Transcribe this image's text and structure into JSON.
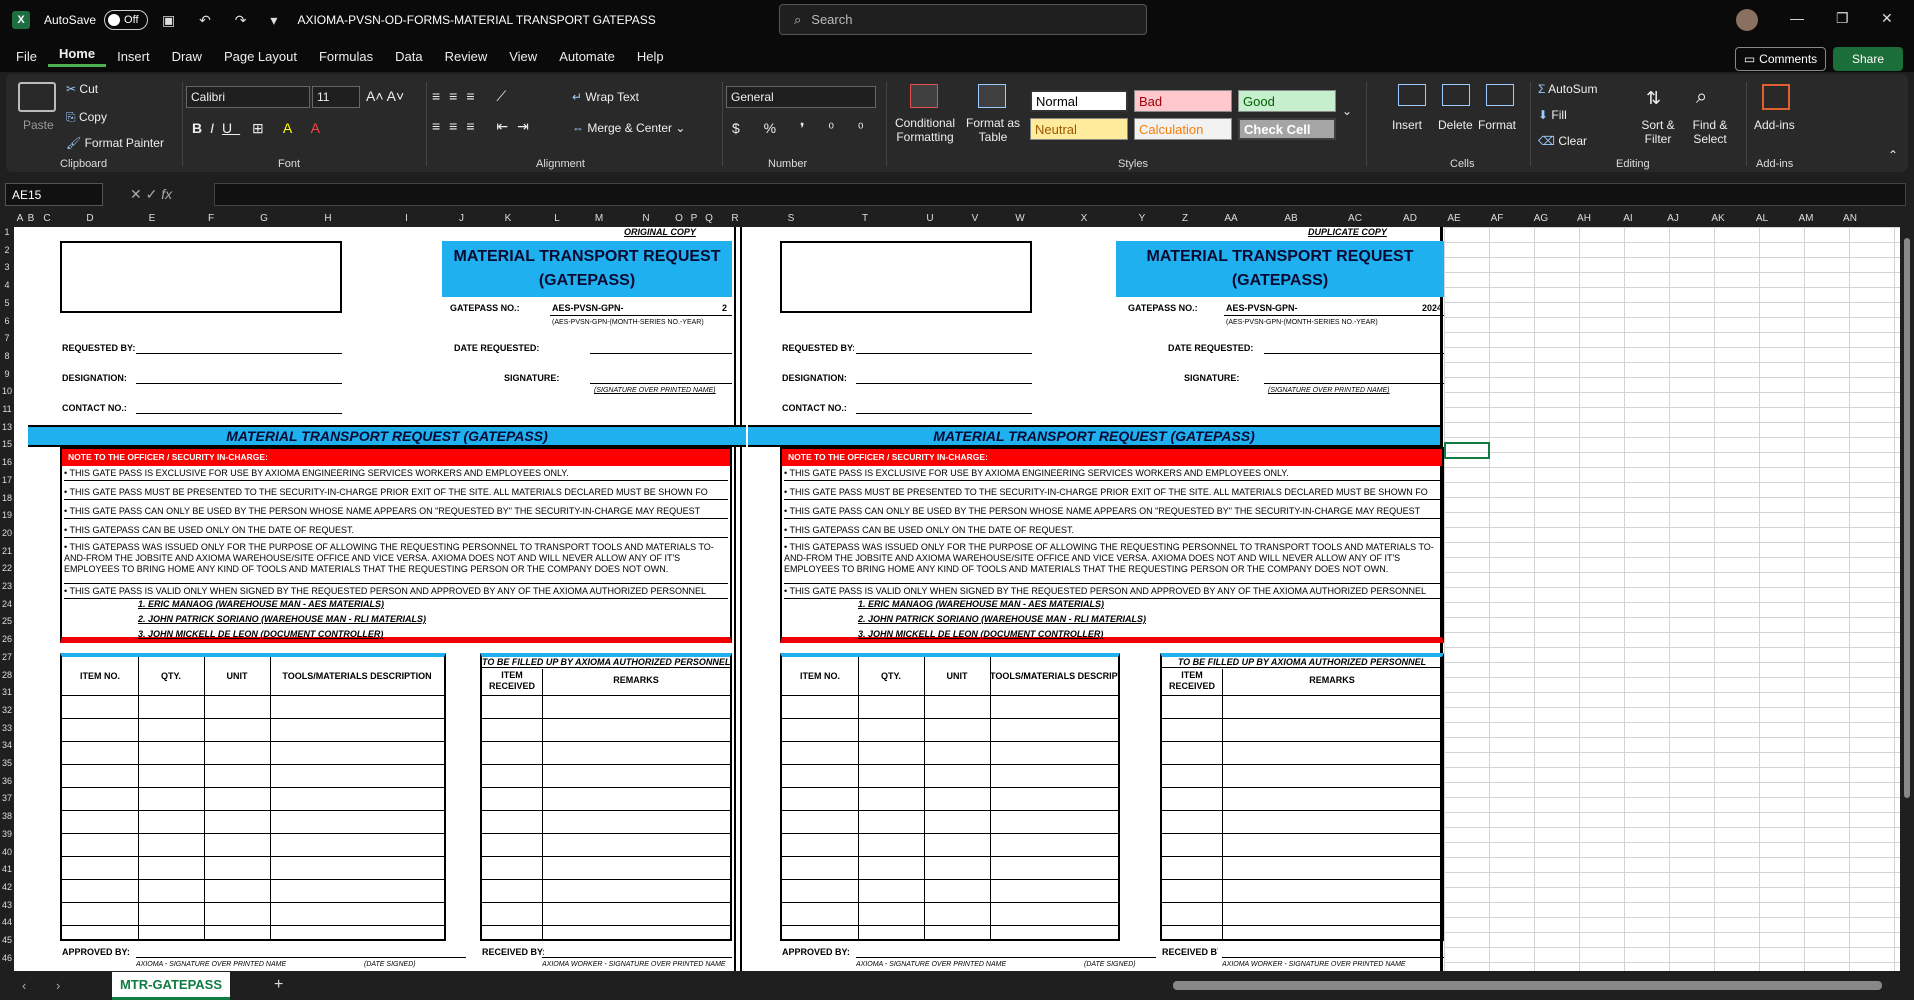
{
  "titlebar": {
    "autosave": "AutoSave",
    "toggle": "Off",
    "doc_title": "AXIOMA-PVSN-OD-FORMS-MATERIAL TRANSPORT GATEPASS",
    "search_placeholder": "Search"
  },
  "menu": {
    "items": [
      "File",
      "Home",
      "Insert",
      "Draw",
      "Page Layout",
      "Formulas",
      "Data",
      "Review",
      "View",
      "Automate",
      "Help"
    ],
    "active": "Home",
    "comments": "Comments",
    "share": "Share"
  },
  "ribbon": {
    "clipboard": {
      "paste": "Paste",
      "cut": "Cut",
      "copy": "Copy",
      "format_painter": "Format Painter",
      "label": "Clipboard"
    },
    "font": {
      "family": "Calibri",
      "size": "11",
      "label": "Font"
    },
    "alignment": {
      "wrap": "Wrap Text",
      "merge": "Merge & Center",
      "label": "Alignment"
    },
    "number": {
      "format": "General",
      "label": "Number"
    },
    "styles": {
      "conditional": "Conditional Formatting",
      "format_table": "Format as Table",
      "normal": "Normal",
      "bad": "Bad",
      "good": "Good",
      "neutral": "Neutral",
      "calculation": "Calculation",
      "check_cell": "Check Cell",
      "label": "Styles"
    },
    "cells": {
      "insert": "Insert",
      "delete": "Delete",
      "format": "Format",
      "label": "Cells"
    },
    "editing": {
      "autosum": "AutoSum",
      "fill": "Fill",
      "clear": "Clear",
      "sort": "Sort & Filter",
      "find": "Find & Select",
      "label": "Editing"
    },
    "addins": {
      "addins": "Add-ins",
      "label": "Add-ins"
    }
  },
  "namebox": "AE15",
  "columns": [
    "A",
    "B",
    "C",
    "D",
    "E",
    "F",
    "G",
    "H",
    "I",
    "J",
    "K",
    "L",
    "M",
    "N",
    "O",
    "P",
    "Q",
    "R",
    "S",
    "T",
    "U",
    "V",
    "W",
    "X",
    "Y",
    "Z",
    "AA",
    "AB",
    "AC",
    "AD",
    "AE",
    "AF",
    "AG",
    "AH",
    "AI",
    "AJ",
    "AK",
    "AL",
    "AM",
    "AN"
  ],
  "rows": [
    "1",
    "2",
    "3",
    "4",
    "5",
    "6",
    "7",
    "8",
    "9",
    "10",
    "11",
    "13",
    "15",
    "16",
    "17",
    "18",
    "19",
    "20",
    "21",
    "22",
    "23",
    "24",
    "25",
    "26",
    "27",
    "28",
    "31",
    "32",
    "33",
    "34",
    "35",
    "36",
    "37",
    "38",
    "39",
    "40",
    "41",
    "42",
    "43",
    "44",
    "45",
    "46"
  ],
  "forms": {
    "original": {
      "copy_label": "ORIGINAL COPY",
      "gp_suffix": "2"
    },
    "duplicate": {
      "copy_label": "DUPLICATE COPY",
      "gp_suffix": "2024"
    },
    "title_line1": "MATERIAL TRANSPORT REQUEST",
    "title_line2": "(GATEPASS)",
    "gatepass_no": "GATEPASS NO.:",
    "gp_code": "AES-PVSN-GPN-",
    "gp_format": "(AES-PVSN-GPN-(MONTH-SERIES NO.-YEAR)",
    "requested_by": "REQUESTED BY:",
    "designation": "DESIGNATION:",
    "contact_no": "CONTACT NO.:",
    "date_requested": "DATE REQUESTED:",
    "signature": "SIGNATURE:",
    "sig_over_name": "(SIGNATURE OVER PRINTED NAME)",
    "bar_title": "MATERIAL TRANSPORT REQUEST (GATEPASS)",
    "note_header": "NOTE TO THE OFFICER / SECURITY IN-CHARGE:",
    "notes": [
      "• THIS GATE PASS IS EXCLUSIVE FOR USE BY AXIOMA ENGINEERING SERVICES WORKERS AND EMPLOYEES ONLY.",
      "• THIS GATE PASS MUST BE PRESENTED TO THE SECURITY-IN-CHARGE PRIOR EXIT OF THE SITE. ALL MATERIALS DECLARED MUST BE SHOWN FO",
      "• THIS GATE PASS CAN ONLY BE USED BY THE PERSON WHOSE NAME APPEARS ON \"REQUESTED BY\" THE SECURITY-IN-CHARGE MAY REQUEST",
      "• THIS GATEPASS CAN BE USED ONLY ON THE DATE OF REQUEST.",
      "• THIS GATEPASS WAS ISSUED ONLY FOR THE PURPOSE OF ALLOWING THE REQUESTING PERSONNEL TO TRANSPORT TOOLS AND MATERIALS TO-AND-FROM THE JOBSITE AND AXIOMA WAREHOUSE/SITE OFFICE AND VICE VERSA. AXIOMA DOES NOT AND WILL NEVER ALLOW ANY OF IT'S EMPLOYEES TO BRING HOME ANY KIND OF TOOLS AND MATERIALS THAT THE REQUESTING PERSON OR THE COMPANY DOES NOT OWN.",
      "• THIS GATE PASS IS VALID ONLY WHEN SIGNED BY THE REQUESTED PERSON AND APPROVED BY ANY OF THE AXIOMA AUTHORIZED PERSONNEL"
    ],
    "authorized": [
      "1. ERIC MANAOG (WAREHOUSE MAN - AES MATERIALS)",
      "2. JOHN PATRICK SORIANO (WAREHOUSE MAN - RLI MATERIALS)",
      "3. JOHN MICKELL DE LEON (DOCUMENT CONTROLLER)"
    ],
    "table_headers": {
      "item_no": "ITEM NO.",
      "qty": "QTY.",
      "unit": "UNIT",
      "desc": "TOOLS/MATERIALS DESCRIPTION"
    },
    "auth_header": "TO BE FILLED UP BY AXIOMA AUTHORIZED PERSONNEL",
    "item_received": "ITEM RECEIVED",
    "remarks": "REMARKS",
    "approved_by": "APPROVED BY:",
    "received_by": "RECEIVED BY:",
    "approver_sig": "AXIOMA - SIGNATURE OVER PRINTED NAME",
    "date_signed": "(DATE SIGNED)",
    "worker_sig": "AXIOMA WORKER - SIGNATURE OVER PRINTED NAME"
  },
  "sheet_tab": "MTR-GATEPASS"
}
